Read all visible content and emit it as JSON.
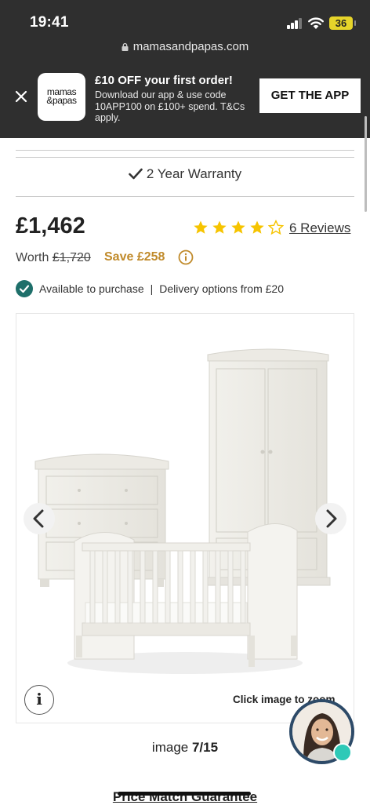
{
  "status_bar": {
    "time": "19:41",
    "battery": "36",
    "battery_color": "#e6d42a"
  },
  "browser": {
    "url": "mamasandpapas.com"
  },
  "app_banner": {
    "logo_line1": "mamas",
    "logo_line2": "&papas",
    "title": "£10 OFF your first order!",
    "description": "Download our app & use code 10APP100 on £100+ spend. T&Cs apply.",
    "cta_label": "GET THE APP",
    "close_icon": "close-icon"
  },
  "product": {
    "warranty_text": "2 Year Warranty",
    "price": "£1,462",
    "rating": 4,
    "rating_max": 5,
    "reviews_link": "6 Reviews",
    "worth_label": "Worth",
    "worth_price": "£1,720",
    "save_text": "Save £258",
    "availability": "Available to purchase",
    "separator": "|",
    "delivery": "Delivery options from £20",
    "accent_color": "#c08a2a",
    "star_color": "#f6c400",
    "status_color": "#1e6f6a"
  },
  "gallery": {
    "zoom_hint": "Click image to zoom",
    "counter_label": "image",
    "counter_value": "7/15",
    "prev_icon": "chevron-left-icon",
    "next_icon": "chevron-right-icon",
    "info_icon": "info-icon"
  },
  "footer": {
    "price_match": "Price Match Guarantee"
  }
}
